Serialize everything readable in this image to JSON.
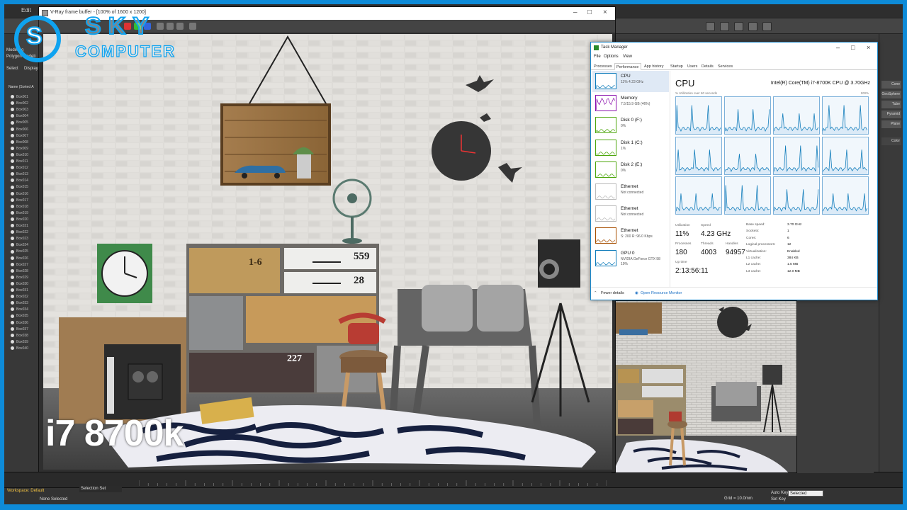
{
  "max": {
    "menu": [
      "Edit"
    ],
    "scene_explorer": {
      "tabs": [
        "Modeling",
        "Polygon Modeli",
        "Select",
        "Display"
      ],
      "columns": [
        "Name (Sorted A"
      ],
      "rows": [
        "Box001",
        "Box002",
        "Box003",
        "Box004",
        "Box005",
        "Box006",
        "Box007",
        "Box008",
        "Box009",
        "Box010",
        "Box011",
        "Box012",
        "Box013",
        "Box014",
        "Box015",
        "Box016",
        "Box017",
        "Box018",
        "Box019",
        "Box020",
        "Box021",
        "Box022",
        "Box023",
        "Box024",
        "Box025",
        "Box026",
        "Box027",
        "Box028",
        "Box029",
        "Box030",
        "Box031",
        "Box032",
        "Box033",
        "Box034",
        "Box035",
        "Box036",
        "Box037",
        "Box038",
        "Box039",
        "Box040"
      ]
    },
    "right_panel": [
      "Cone",
      "GeoSphere",
      "Tube",
      "Pyramid",
      "Plane"
    ],
    "right_panel_extra": [
      "Color"
    ],
    "status": {
      "workspace": "Workspace: Default",
      "selection": "None Selected",
      "selection_set": "Selection Set",
      "grid": "Grid = 10.0mm",
      "autokey": "Auto Key",
      "selected": "Selected",
      "set_key": "Set Key"
    }
  },
  "frame_buffer": {
    "title": "V-Ray frame buffer - [100% of 1600 x 1200]"
  },
  "scene": {
    "tags": [
      "559",
      "28",
      "227",
      "1-6"
    ]
  },
  "overlay": {
    "cpu_label": "i7 8700k"
  },
  "logo": {
    "s": "S",
    "sky": "SKY",
    "computer": "COMPUTER"
  },
  "task_manager": {
    "title": "Task Manager",
    "menu": [
      "File",
      "Options",
      "View"
    ],
    "tabs": [
      "Processes",
      "Performance",
      "App history",
      "Startup",
      "Users",
      "Details",
      "Services"
    ],
    "active_tab": "Performance",
    "sidebar": [
      {
        "name": "CPU",
        "sub": "11%  4.23 GHz",
        "color": "#117dbb"
      },
      {
        "name": "Memory",
        "sub": "7.5/15.9 GB (46%)",
        "color": "#8b12ae"
      },
      {
        "name": "Disk 0 (F:)",
        "sub": "0%",
        "color": "#4da60c"
      },
      {
        "name": "Disk 1 (C:)",
        "sub": "1%",
        "color": "#4da60c"
      },
      {
        "name": "Disk 2 (E:)",
        "sub": "0%",
        "color": "#4da60c"
      },
      {
        "name": "Ethernet",
        "sub": "Not connected",
        "color": "#bbbbbb"
      },
      {
        "name": "Ethernet",
        "sub": "Not connected",
        "color": "#bbbbbb"
      },
      {
        "name": "Ethernet",
        "sub": "S: 200  R: 96.0 Kbps",
        "color": "#a74f01"
      },
      {
        "name": "GPU 0",
        "sub": "NVIDIA GeForce GTX 98",
        "sub2": "19%",
        "color": "#117dbb"
      }
    ],
    "main": {
      "heading": "CPU",
      "model": "Intel(R) Core(TM) i7-8700K CPU @ 3.70GHz",
      "util_caption": "% Utilization over 60 seconds",
      "util_max": "100%",
      "stats": [
        {
          "label": "Utilization",
          "value": "11%"
        },
        {
          "label": "Speed",
          "value": "4.23 GHz"
        },
        {
          "label": "Processes",
          "value": "180"
        },
        {
          "label": "Threads",
          "value": "4003"
        },
        {
          "label": "Handles",
          "value": "94957"
        },
        {
          "label": "Up time",
          "value": "2:13:56:11"
        }
      ],
      "specs": [
        {
          "label": "Base speed:",
          "value": "3.70 GHz"
        },
        {
          "label": "Sockets:",
          "value": "1"
        },
        {
          "label": "Cores:",
          "value": "6"
        },
        {
          "label": "Logical processors:",
          "value": "12"
        },
        {
          "label": "Virtualization:",
          "value": "Enabled"
        },
        {
          "label": "L1 cache:",
          "value": "384 KB"
        },
        {
          "label": "L2 cache:",
          "value": "1.5 MB"
        },
        {
          "label": "L3 cache:",
          "value": "12.0 MB"
        }
      ]
    },
    "footer": {
      "fewer": "Fewer details",
      "monitor": "Open Resource Monitor"
    }
  }
}
